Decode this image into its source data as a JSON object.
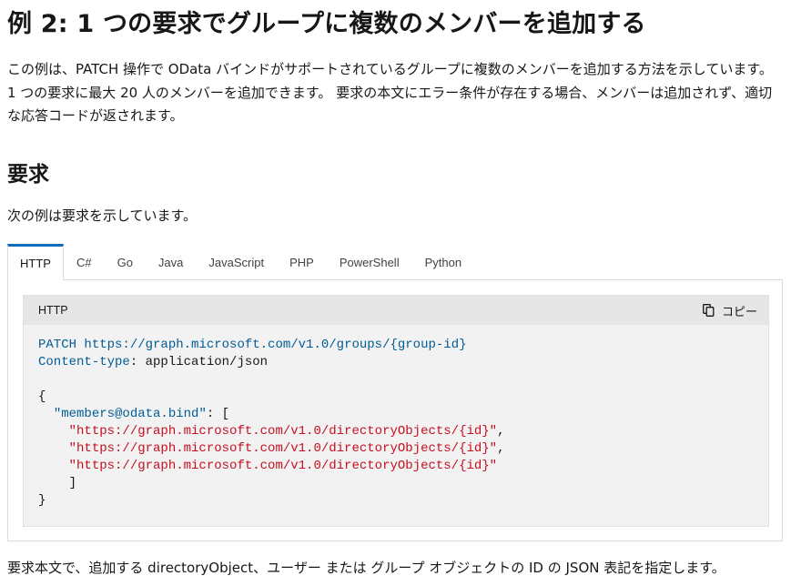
{
  "heading": "例 2: 1 つの要求でグループに複数のメンバーを追加する",
  "intro": "この例は、PATCH 操作で OData バインドがサポートされているグループに複数のメンバーを追加する方法を示しています。 1 つの要求に最大 20 人のメンバーを追加できます。 要求の本文にエラー条件が存在する場合、メンバーは追加されず、適切な応答コードが返されます。",
  "request_heading": "要求",
  "request_desc": "次の例は要求を示しています。",
  "tabs": [
    {
      "label": "HTTP",
      "active": true
    },
    {
      "label": "C#"
    },
    {
      "label": "Go"
    },
    {
      "label": "Java"
    },
    {
      "label": "JavaScript"
    },
    {
      "label": "PHP"
    },
    {
      "label": "PowerShell"
    },
    {
      "label": "Python"
    }
  ],
  "code": {
    "language": "HTTP",
    "copy_label": "コピー",
    "method": "PATCH",
    "url": "https://graph.microsoft.com/v1.0/groups/{group-id}",
    "header_name": "Content-type",
    "header_value": ": application/json",
    "open_brace": "{",
    "prop_key": "\"members@odata.bind\"",
    "prop_sep": ": [",
    "items": [
      "\"https://graph.microsoft.com/v1.0/directoryObjects/{id}\"",
      "\"https://graph.microsoft.com/v1.0/directoryObjects/{id}\"",
      "\"https://graph.microsoft.com/v1.0/directoryObjects/{id}\""
    ],
    "comma": ",",
    "close_bracket": "]",
    "close_brace": "}"
  },
  "footer": "要求本文で、追加する directoryObject、ユーザー または グループ オブジェクトの ID の JSON 表記を指定します。"
}
